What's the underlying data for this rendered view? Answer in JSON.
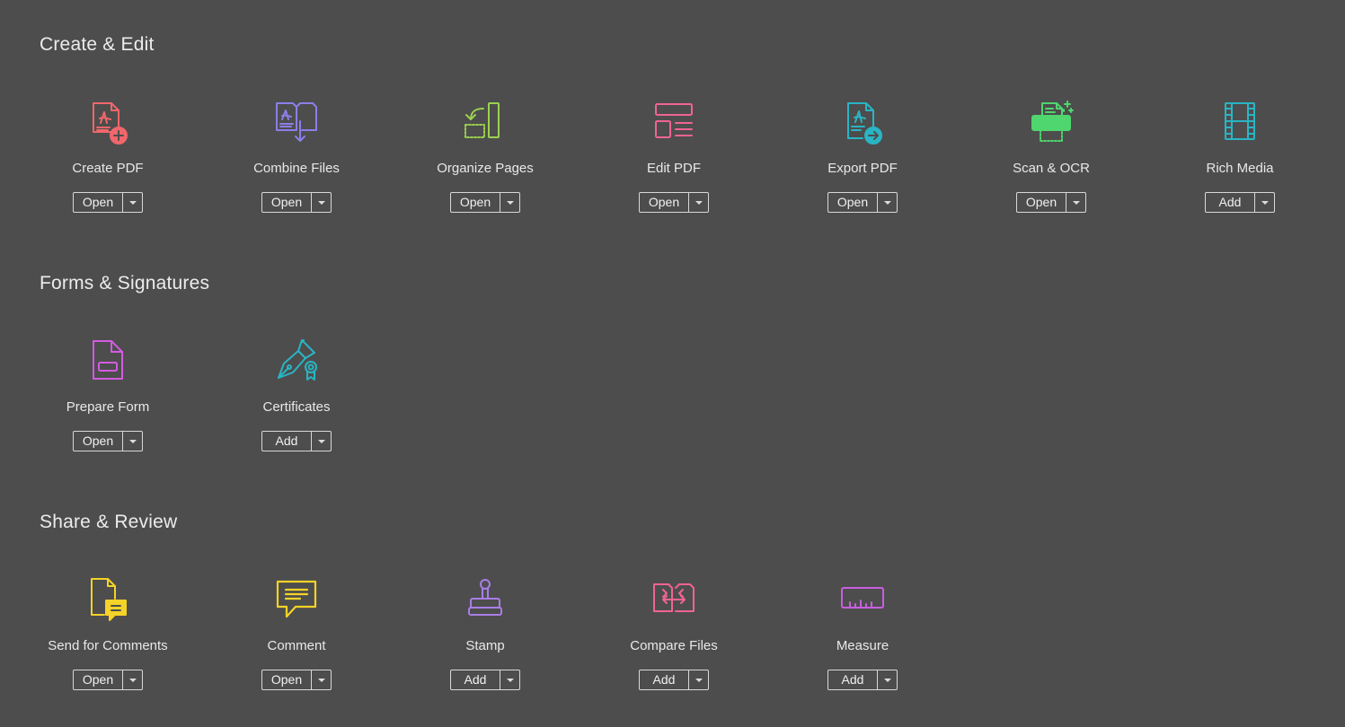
{
  "sections": [
    {
      "title": "Create & Edit",
      "tools": [
        {
          "label": "Create PDF",
          "action": "Open",
          "icon": "create-pdf-icon",
          "color": "#f0676b"
        },
        {
          "label": "Combine Files",
          "action": "Open",
          "icon": "combine-files-icon",
          "color": "#8b7fe8"
        },
        {
          "label": "Organize Pages",
          "action": "Open",
          "icon": "organize-pages-icon",
          "color": "#9bd24e"
        },
        {
          "label": "Edit PDF",
          "action": "Open",
          "icon": "edit-pdf-icon",
          "color": "#f06493"
        },
        {
          "label": "Export PDF",
          "action": "Open",
          "icon": "export-pdf-icon",
          "color": "#29b5c4"
        },
        {
          "label": "Scan & OCR",
          "action": "Open",
          "icon": "scan-ocr-icon",
          "color": "#4fd66e"
        },
        {
          "label": "Rich Media",
          "action": "Add",
          "icon": "rich-media-icon",
          "color": "#29b5c4"
        }
      ]
    },
    {
      "title": "Forms & Signatures",
      "tools": [
        {
          "label": "Prepare Form",
          "action": "Open",
          "icon": "prepare-form-icon",
          "color": "#d35be0"
        },
        {
          "label": "Certificates",
          "action": "Add",
          "icon": "certificates-icon",
          "color": "#29b5c4"
        }
      ]
    },
    {
      "title": "Share & Review",
      "tools": [
        {
          "label": "Send for Comments",
          "action": "Open",
          "icon": "send-for-comments-icon",
          "color": "#f5d327"
        },
        {
          "label": "Comment",
          "action": "Open",
          "icon": "comment-icon",
          "color": "#f5d327"
        },
        {
          "label": "Stamp",
          "action": "Add",
          "icon": "stamp-icon",
          "color": "#a97ee6"
        },
        {
          "label": "Compare Files",
          "action": "Add",
          "icon": "compare-files-icon",
          "color": "#f06493"
        },
        {
          "label": "Measure",
          "action": "Add",
          "icon": "measure-icon",
          "color": "#c85fe0"
        }
      ]
    }
  ]
}
